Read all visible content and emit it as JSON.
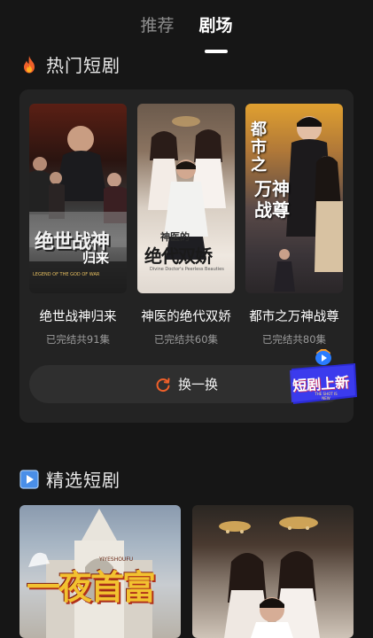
{
  "tabs": [
    {
      "label": "推荐",
      "active": false
    },
    {
      "label": "剧场",
      "active": true
    }
  ],
  "hot": {
    "title": "热门短剧",
    "icon": "fire-icon",
    "dramas": [
      {
        "title": "绝世战神归来",
        "status": "已完结共91集",
        "poster_text": "绝世战神",
        "poster_text2": "归来",
        "poster_sub": "LEGEND OF THE GOD OF WAR"
      },
      {
        "title": "神医的绝代双娇",
        "status": "已完结共60集",
        "poster_text": "神医的",
        "poster_text2": "绝代双娇",
        "poster_sub": "Divine Doctor's Peerless Beauties"
      },
      {
        "title": "都市之万神战尊",
        "status": "已完结共80集",
        "poster_text": "都市之",
        "poster_text2": "万神战尊",
        "poster_sub": ""
      }
    ],
    "refresh_label": "换一换",
    "refresh_icon": "refresh-icon"
  },
  "badge": {
    "text": "短剧上新",
    "sub": "THE SHOT IS NEW"
  },
  "featured": {
    "title": "精选短剧",
    "icon": "play-icon",
    "items": [
      {
        "poster_text": "一夜首富",
        "poster_sub": "YIYESHOUFU"
      },
      {
        "poster_text": ""
      }
    ]
  },
  "colors": {
    "background": "#161616",
    "card": "#232323",
    "accent": "#f0602a",
    "muted": "#9a9a9a"
  }
}
